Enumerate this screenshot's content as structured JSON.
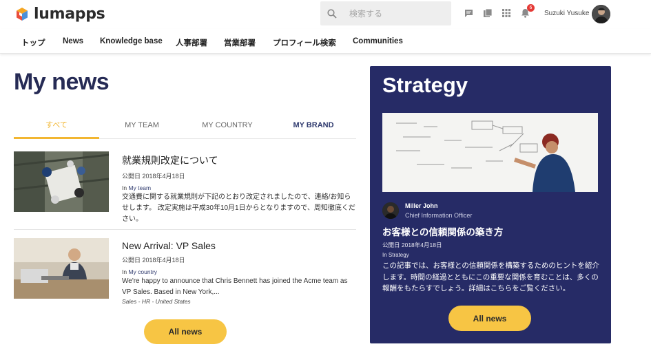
{
  "header": {
    "logo_text": "lumapps",
    "search_placeholder": "検索する",
    "notification_count": "6",
    "user_name": "Suzuki Yusuke",
    "icons": [
      "search-icon",
      "chat-icon",
      "library-icon",
      "apps-grid-icon",
      "bell-icon"
    ]
  },
  "nav": {
    "items": [
      "トップ",
      "News",
      "Knowledge base",
      "人事部署",
      "営業部署",
      "プロフィール検索",
      "Communities"
    ]
  },
  "main": {
    "title": "My news",
    "tabs": [
      "すべて",
      "MY TEAM",
      "MY COUNTRY",
      "MY BRAND"
    ],
    "active_tab": "すべて",
    "articles": [
      {
        "title": "就業規則改定について",
        "date": "公開日 2018年4月18日",
        "in_label": "In ",
        "category": "My team",
        "text": "交通費に関する就業規則が下記のとおり改定されましたので、連絡/お知らせします。 改定実施は平成30年10月1日からとなりますので、周知徹底ください。"
      },
      {
        "title": "New Arrival: VP Sales",
        "date": "公開日 2018年4月18日",
        "in_label": "In ",
        "category": "My country",
        "text": "We're happy to announce that Chris Bennett has joined the Acme team as VP Sales. Based in New York,...",
        "tags": "Sales - HR - United States"
      }
    ],
    "all_news_label": "All news"
  },
  "card": {
    "title": "Strategy",
    "author_name": "Miller John",
    "author_role": "Chief Information Officer",
    "headline": "お客様との信頼関係の築き方",
    "date": "公開日 2018年4月18日",
    "category": "In Strategy",
    "text": "この記事では、お客様との信頼関係を構築するためのヒントを紹介します。時間の経過とともにこの重要な関係を育むことは、多くの報酬をもたらすでしょう。詳細はこちらをご覧ください。",
    "button_label": "All news"
  },
  "colors": {
    "accent": "#f7c544",
    "brand_navy": "#262b66",
    "title_navy": "#262b55",
    "tab_active": "#f2b631",
    "badge_red": "#e53935"
  }
}
